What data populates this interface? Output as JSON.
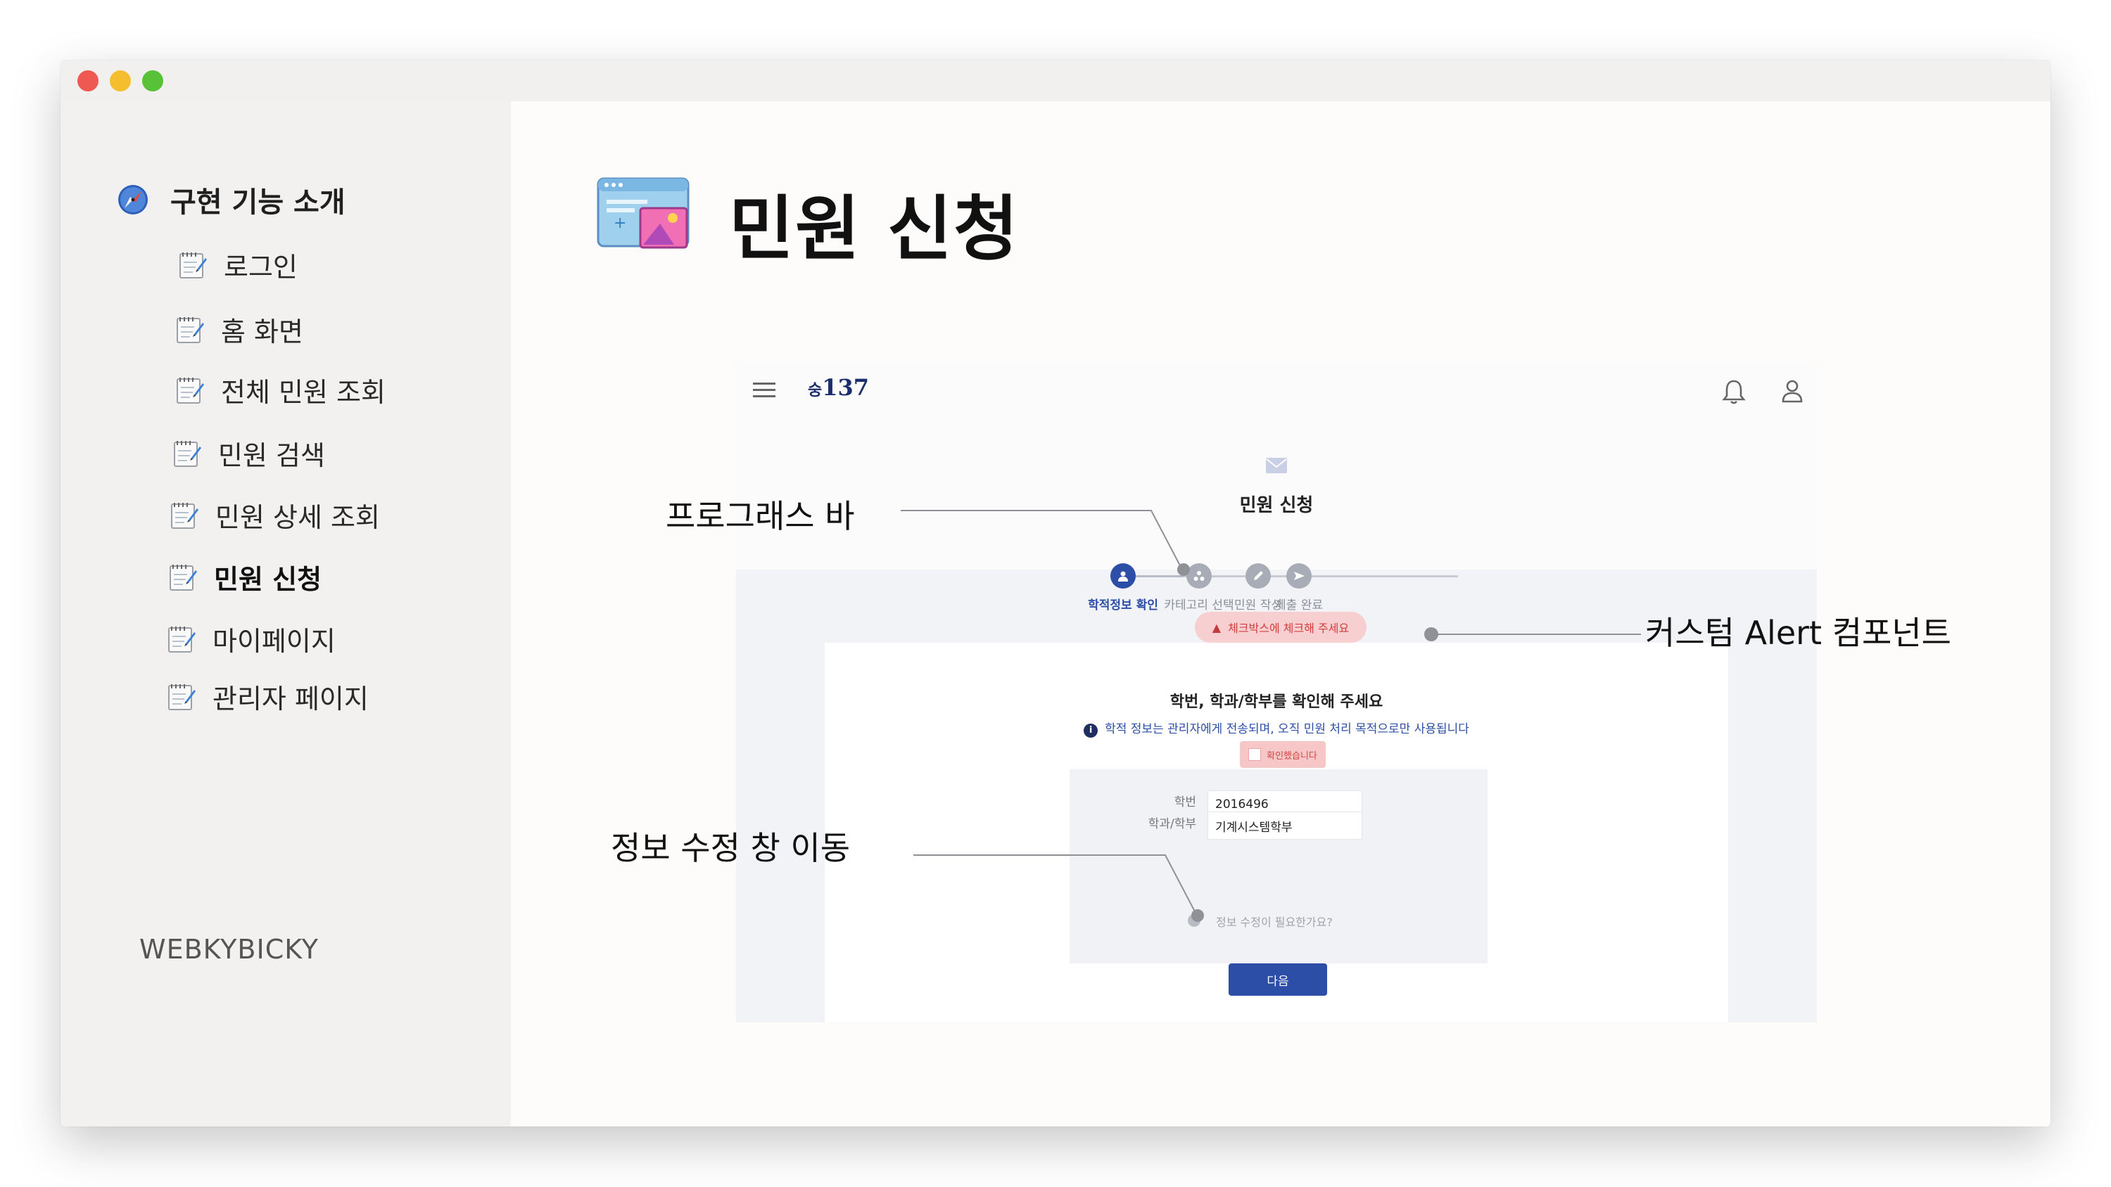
{
  "sidebar": {
    "title": "구현 기능 소개",
    "items": [
      {
        "label": "로그인",
        "active": false
      },
      {
        "label": "홈 화면",
        "active": false
      },
      {
        "label": "전체 민원 조회",
        "active": false
      },
      {
        "label": "민원 검색",
        "active": false
      },
      {
        "label": "민원 상세 조회",
        "active": false
      },
      {
        "label": "민원 신청",
        "active": true
      },
      {
        "label": "마이페이지",
        "active": false
      },
      {
        "label": "관리자 페이지",
        "active": false
      }
    ],
    "brand": "WEBKYBICKY"
  },
  "page": {
    "title": "민원 신청",
    "icon": "window-image-icon"
  },
  "mock": {
    "logo": "137",
    "logo_prefix": "숭",
    "heading": "민원 신청",
    "steps": [
      {
        "label": "학적정보 확인",
        "active": true,
        "icon": "person-icon"
      },
      {
        "label": "카테고리 선택",
        "active": false,
        "icon": "category-icon"
      },
      {
        "label": "민원 작성",
        "active": false,
        "icon": "pencil-icon"
      },
      {
        "label": "제출 완료",
        "active": false,
        "icon": "send-icon"
      }
    ],
    "alert": "체크박스에 체크해 주세요",
    "card_title": "학번, 학과/학부를 확인해 주세요",
    "info": "학적 정보는 관리자에게 전송되며, 오직 민원 처리 목적으로만 사용됩니다",
    "confirm": "확인했습니다",
    "fields": [
      {
        "label": "학번",
        "value": "2016496"
      },
      {
        "label": "학과/학부",
        "value": "기계시스템학부"
      }
    ],
    "edit_link": "정보 수정이 필요한가요?",
    "next_button": "다음"
  },
  "callouts": {
    "progress": "프로그래스 바",
    "alert": "커스텀 Alert 컴포넌트",
    "edit": "정보 수정 창 이동"
  },
  "colors": {
    "primary": "#2d4ea6",
    "alert_bg": "#f8cfd0",
    "alert_text": "#d03c3c"
  }
}
